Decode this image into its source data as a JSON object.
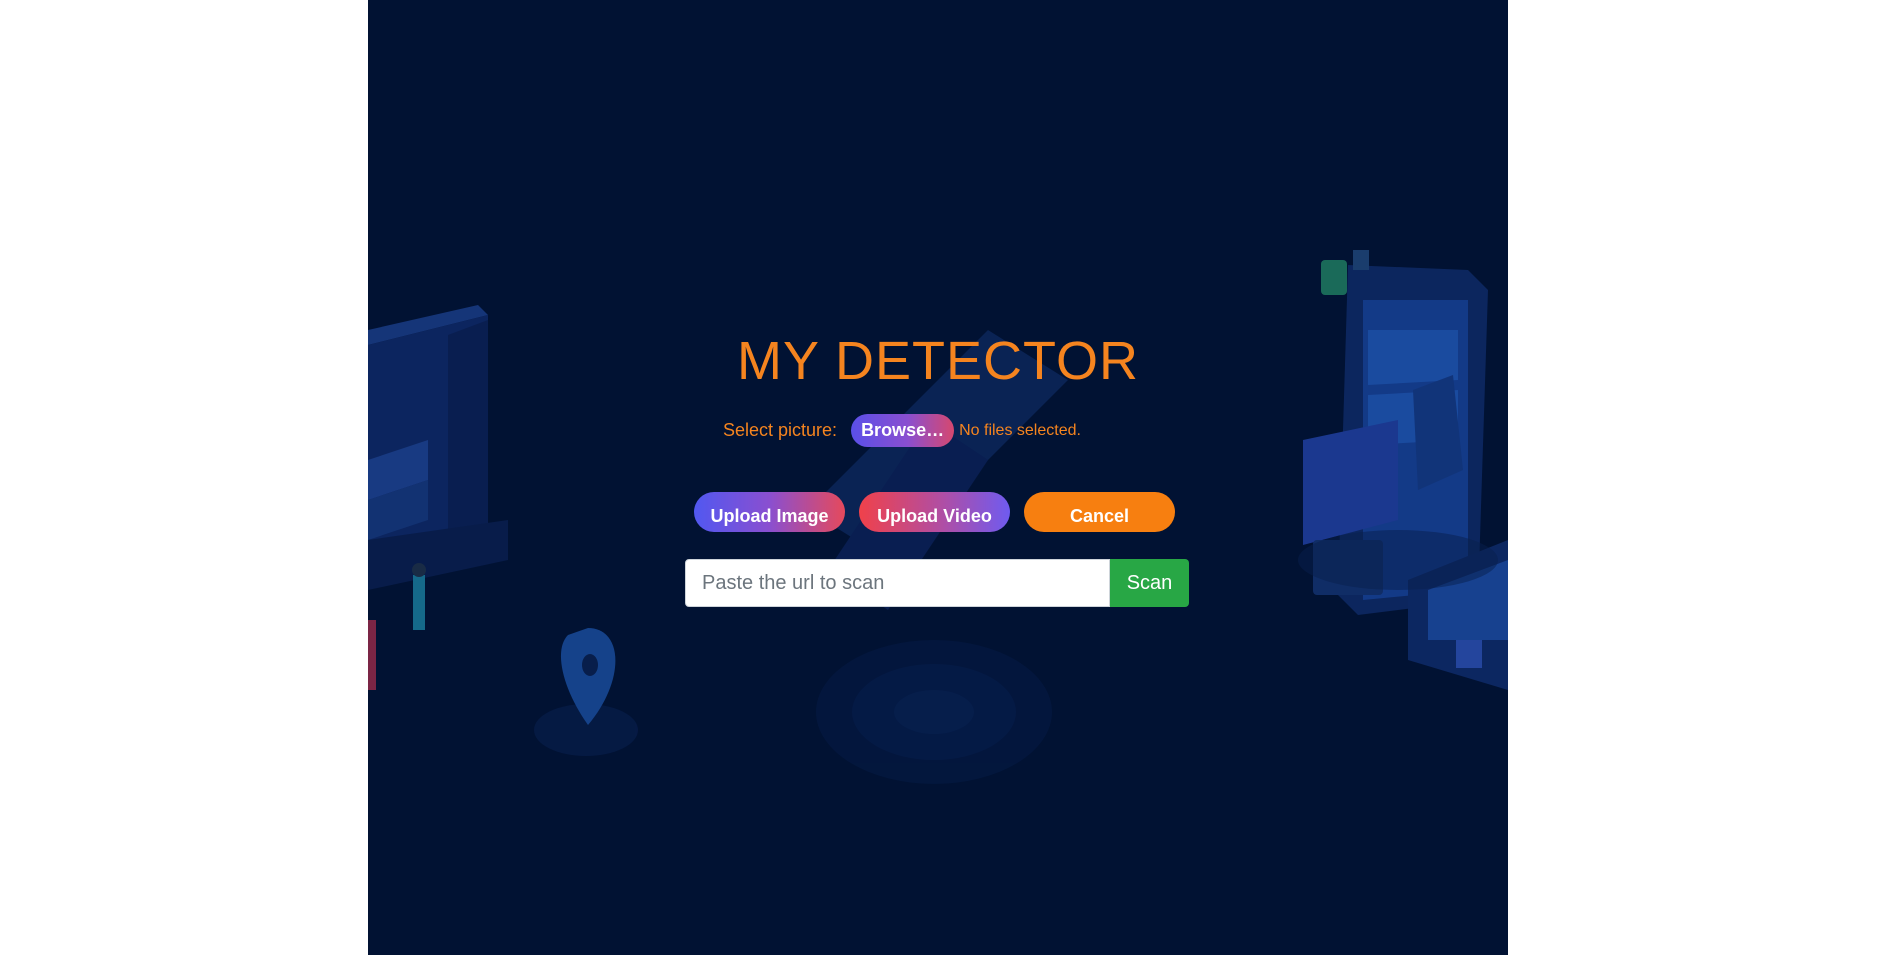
{
  "app": {
    "title": "MY DETECTOR"
  },
  "file_picker": {
    "label": "Select picture:",
    "browse_label": "Browse…",
    "status": "No files selected."
  },
  "actions": {
    "upload_image": "Upload Image",
    "upload_video": "Upload Video",
    "cancel": "Cancel"
  },
  "scan": {
    "placeholder": "Paste the url to scan",
    "button_label": "Scan"
  },
  "colors": {
    "background": "#011233",
    "accent": "#f5841f",
    "scan_button": "#28a745",
    "cancel_button": "#f77f10"
  }
}
